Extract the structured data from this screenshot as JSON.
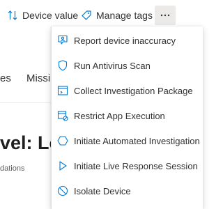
{
  "toolbar": {
    "device_value_label": "Device value",
    "manage_tags_label": "Manage tags",
    "more_icon": "more-ellipsis-icon"
  },
  "background": {
    "tab_1": "es",
    "tab_2": "Missi",
    "title": "vel: Lo",
    "subtitle": "dations"
  },
  "menu": {
    "items": [
      {
        "label": "Report device inaccuracy",
        "icon": "report-person-icon"
      },
      {
        "label": "Run Antivirus Scan",
        "icon": "shield-icon"
      },
      {
        "label": "Collect Investigation Package",
        "icon": "package-icon"
      },
      {
        "label": "Restrict App Execution",
        "icon": "restrict-app-icon"
      },
      {
        "label": "Initiate Automated Investigation",
        "icon": "hexagon-icon"
      },
      {
        "label": "Initiate Live Response Session",
        "icon": "play-icon"
      },
      {
        "label": "Isolate Device",
        "icon": "isolate-icon"
      }
    ]
  },
  "colors": {
    "accent": "#0078d4",
    "text": "#323130",
    "more_button_bg": "#eceae8"
  }
}
